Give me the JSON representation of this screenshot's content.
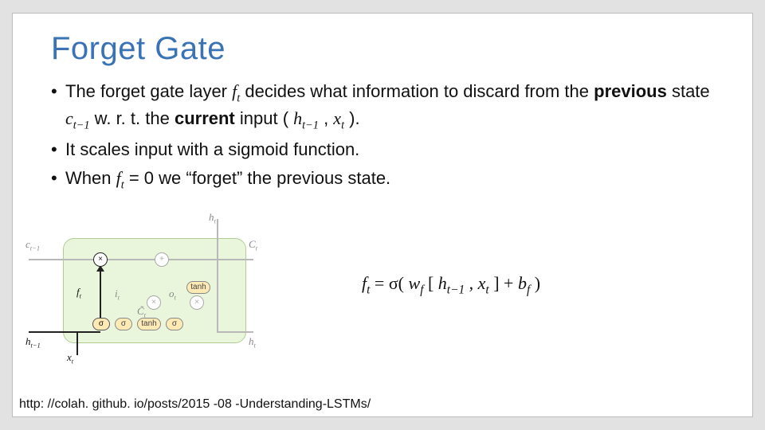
{
  "title": "Forget Gate",
  "bullets": {
    "b1_a": "The forget gate layer ",
    "b1_ft": "f",
    "b1_ft_sub": "t",
    "b1_b": " decides what information to discard from the ",
    "b1_prev": "previous",
    "b1_c": " state ",
    "b1_ct1": "c",
    "b1_ct1_sub": "t−1",
    "b1_d": " w. r. t. the ",
    "b1_cur": "current",
    "b1_e": " input (",
    "b1_ht1": "h",
    "b1_ht1_sub": "t−1",
    "b1_f": ", ",
    "b1_xt": "x",
    "b1_xt_sub": "t",
    "b1_g": ").",
    "b2": "It scales input with a sigmoid function.",
    "b3_a": "When ",
    "b3_ft": "f",
    "b3_ft_sub": "t",
    "b3_b": " = 0 we “forget” the previous state."
  },
  "diagram": {
    "sigma": "σ",
    "tanh": "tanh",
    "mult": "×",
    "plus": "+",
    "ct1": "c",
    "ct1_sub": "t−1",
    "ct": "C",
    "ct_sub": "t",
    "ht1": "h",
    "ht1_sub": "t−1",
    "ht": "h",
    "ht_sub": "t",
    "xt": "x",
    "xt_sub": "t",
    "ft": "f",
    "ft_sub": "t",
    "it": "i",
    "it_sub": "t",
    "ctld": "C̃",
    "ctld_sub": "t",
    "ot": "o",
    "ot_sub": "t"
  },
  "equation": {
    "lhs_f": "f",
    "lhs_t": "t",
    "eq": " = σ(",
    "wf": "w",
    "wf_sub": "f",
    "sp": " ",
    "lb": "[",
    "h": "h",
    "h_sub": "t−1",
    "comma": ", ",
    "x": "x",
    "x_sub": "t",
    "rb": "] + ",
    "b": "b",
    "b_sub": "f",
    "end": " )"
  },
  "footer": "http: //colah. github. io/posts/2015 -08 -Understanding-LSTMs/"
}
